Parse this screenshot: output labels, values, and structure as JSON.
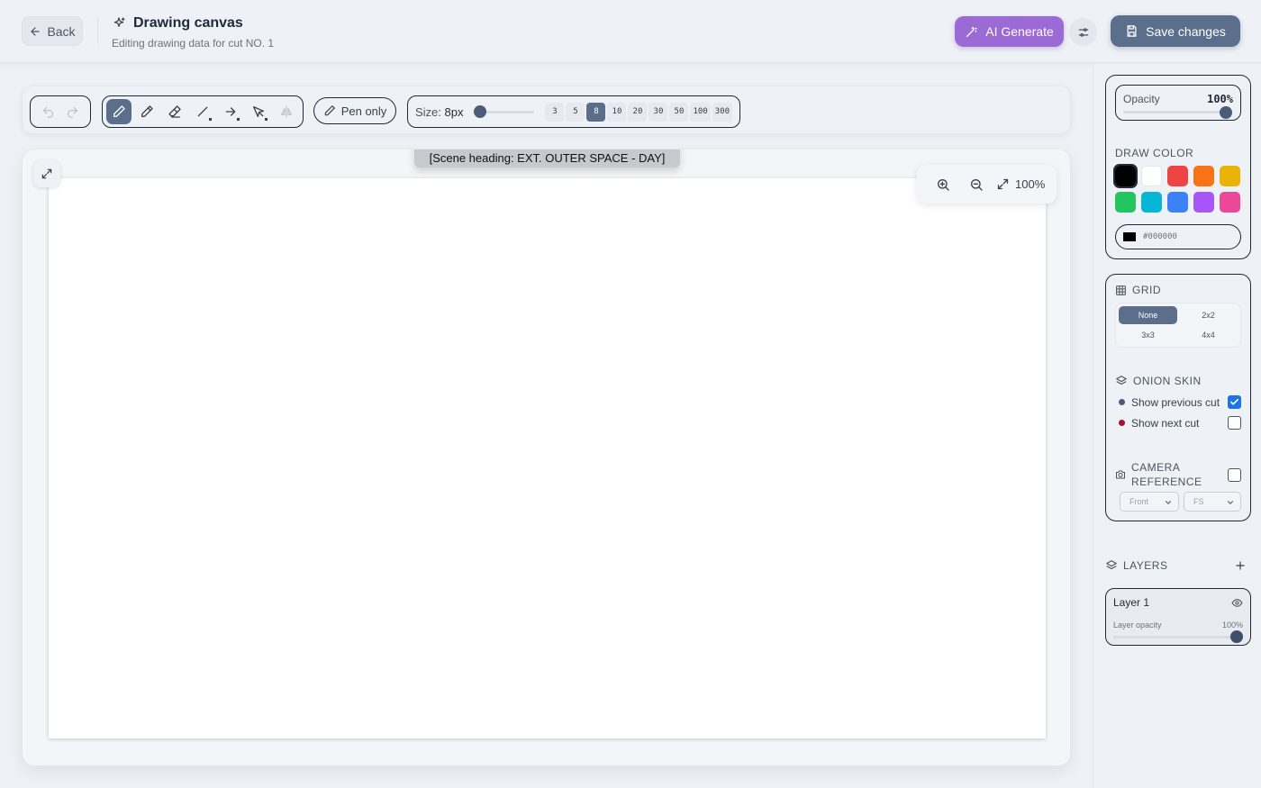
{
  "header": {
    "back_label": "Back",
    "title": "Drawing canvas",
    "subtitle": "Editing drawing data for cut NO. 1",
    "ai_generate_label": "AI Generate",
    "save_label": "Save changes"
  },
  "toolbar": {
    "undo_icon": "undo-icon",
    "redo_icon": "redo-icon",
    "tools": [
      "pen",
      "pencil",
      "eraser",
      "line",
      "arrow",
      "select",
      "mirror"
    ],
    "active_tool": "pen",
    "pen_only_label": "Pen only",
    "size_prefix": "Size:",
    "size_value": "8px",
    "size_presets": [
      "3",
      "5",
      "8",
      "10",
      "20",
      "30",
      "50",
      "100",
      "300"
    ],
    "active_preset": "8"
  },
  "canvas": {
    "scene_heading": "[Scene heading: EXT. OUTER SPACE - DAY]",
    "zoom_level": "100%"
  },
  "panel": {
    "opacity_label": "Opacity",
    "opacity_value": "100%",
    "draw_color_label": "DRAW COLOR",
    "colors": [
      "#000000",
      "#ffffff",
      "#ef4444",
      "#f97316",
      "#eab308",
      "#22c55e",
      "#06b6d4",
      "#3b82f6",
      "#a855f7",
      "#ec4899"
    ],
    "selected_color": "#000000",
    "hex_value": "#000000",
    "grid_label": "GRID",
    "grid_options": [
      "None",
      "2x2",
      "3x3",
      "4x4"
    ],
    "grid_selected": "None",
    "onion_label": "ONION SKIN",
    "onion_prev_label": "Show previous cut",
    "onion_prev_checked": true,
    "onion_prev_color": "#4b5c78",
    "onion_next_label": "Show next cut",
    "onion_next_checked": false,
    "onion_next_color": "#9f1239",
    "camera_label_1": "CAMERA",
    "camera_label_2": "REFERENCE",
    "camera_checked": false,
    "camera_angle": "Front",
    "camera_shot": "FS"
  },
  "layers": {
    "label": "LAYERS",
    "items": [
      {
        "name": "Layer 1",
        "opacity_label": "Layer opacity",
        "opacity_value": "100%"
      }
    ]
  },
  "accent_colors": {
    "ai": "#9b6ad4",
    "primary": "#5b6e8c",
    "checkbox": "#1a73e8"
  }
}
